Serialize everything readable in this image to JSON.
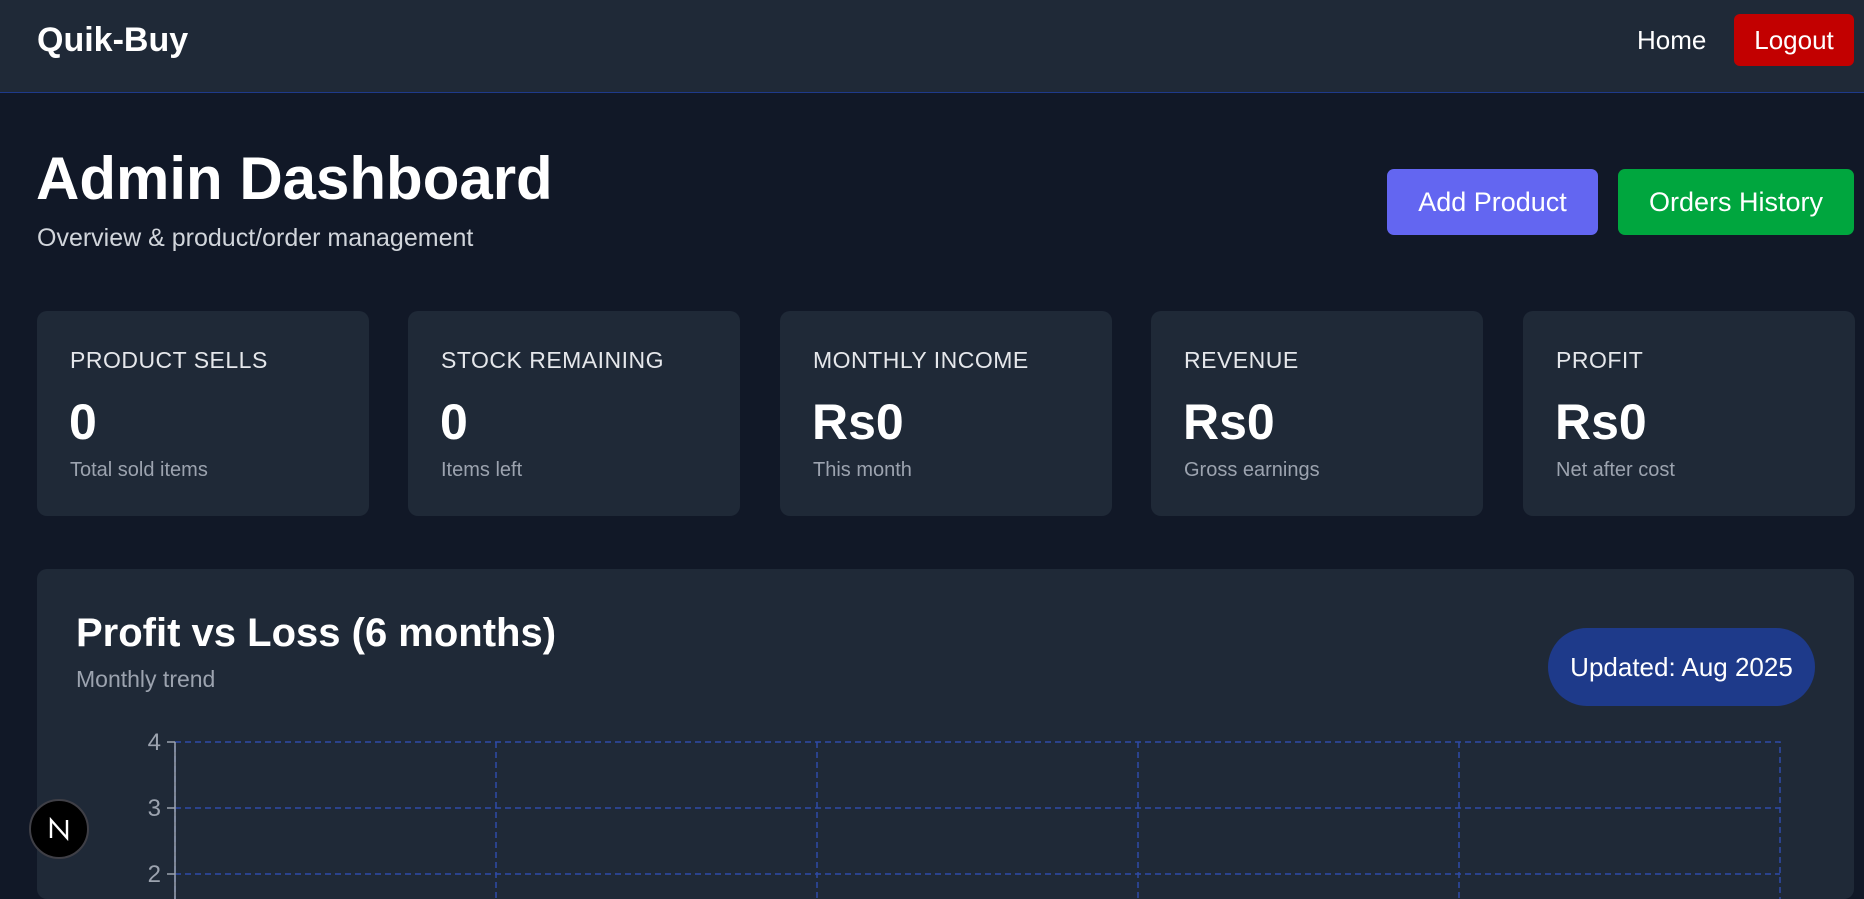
{
  "navbar": {
    "brand": "Quik-Buy",
    "home_label": "Home",
    "logout_label": "Logout"
  },
  "header": {
    "title": "Admin Dashboard",
    "subtitle": "Overview & product/order management",
    "add_product_label": "Add Product",
    "orders_history_label": "Orders History"
  },
  "stats": [
    {
      "label": "PRODUCT SELLS",
      "value": "0",
      "note": "Total sold items"
    },
    {
      "label": "STOCK REMAINING",
      "value": "0",
      "note": "Items left"
    },
    {
      "label": "MONTHLY INCOME",
      "value": "Rs0",
      "note": "This month"
    },
    {
      "label": "REVENUE",
      "value": "Rs0",
      "note": "Gross earnings"
    },
    {
      "label": "PROFIT",
      "value": "Rs0",
      "note": "Net after cost"
    }
  ],
  "chart_panel": {
    "title": "Profit vs Loss (6 months)",
    "subtitle": "Monthly trend",
    "updated": "Updated: Aug 2025"
  },
  "chart_data": {
    "type": "line",
    "y_ticks": [
      4,
      3,
      2
    ],
    "grid": true,
    "series": []
  },
  "colors": {
    "background": "#111827",
    "card": "#1f2937",
    "accent_add": "#6366f1",
    "accent_orders": "#00a63e",
    "logout": "#c20000",
    "badge": "#1e3a8a",
    "grid": "#2e4aa8"
  },
  "icons": {
    "next_badge": "nextjs-logo-icon"
  }
}
